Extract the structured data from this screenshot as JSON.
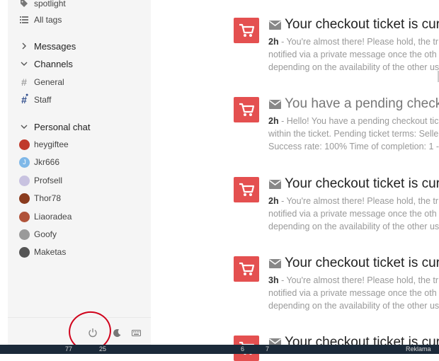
{
  "sidebar": {
    "top_items": [
      {
        "label": "spotlight",
        "icon": "tag-icon"
      },
      {
        "label": "All tags",
        "icon": "list-icon"
      }
    ],
    "sections": {
      "messages": "Messages",
      "channels": "Channels",
      "personal_chat": "Personal chat"
    },
    "channels": [
      {
        "label": "General",
        "icon": "hash-icon"
      },
      {
        "label": "Staff",
        "icon": "hash-lock-icon"
      }
    ],
    "chats": [
      {
        "label": "heygiftee",
        "avatar_color": "#c0392b"
      },
      {
        "label": "Jkr666",
        "avatar_color": "#7fb8e8"
      },
      {
        "label": "Profsell",
        "avatar_color": "#c8c2e0"
      },
      {
        "label": "Thor78",
        "avatar_color": "#8a3b1e"
      },
      {
        "label": "Liaoradea",
        "avatar_color": "#b0533a"
      },
      {
        "label": "Goofy",
        "avatar_color": "#9a9a9a"
      },
      {
        "label": "Maketas",
        "avatar_color": "#555555"
      }
    ],
    "bottom": {
      "power": "power-icon",
      "theme": "moon-icon",
      "keyboard": "keyboard-icon"
    }
  },
  "notifications": [
    {
      "title": "Your checkout ticket is curr",
      "time": "2h",
      "line1": " - You're almost there! Please hold, the tr",
      "line2": "notified via a private message once the oth",
      "line3": "depending on the availability of the other us"
    },
    {
      "title": "You have a pending checko",
      "time": "2h",
      "line1": " - Hello! You have a pending checkout tic",
      "line2": "within the ticket. Pending ticket terms: Selle",
      "line3": "Success rate: 100% Time of completion: 1 -"
    },
    {
      "title": "Your checkout ticket is curr",
      "time": "2h",
      "line1": " - You're almost there! Please hold, the tr",
      "line2": "notified via a private message once the oth",
      "line3": "depending on the availability of the other us"
    },
    {
      "title": "Your checkout ticket is curr",
      "time": "3h",
      "line1": " - You're almost there! Please hold, the tr",
      "line2": "notified via a private message once the oth",
      "line3": "depending on the availability of the other us"
    },
    {
      "title": "Your checkout ticket is curr",
      "time": "",
      "line1": "",
      "line2": "",
      "line3": ""
    }
  ],
  "taskbar": {
    "a": "77",
    "b": "25",
    "c": "6",
    "d": "7",
    "e": "Reklama"
  },
  "colors": {
    "cart_tile": "#e45050",
    "annotation_circle": "#d0021b"
  }
}
